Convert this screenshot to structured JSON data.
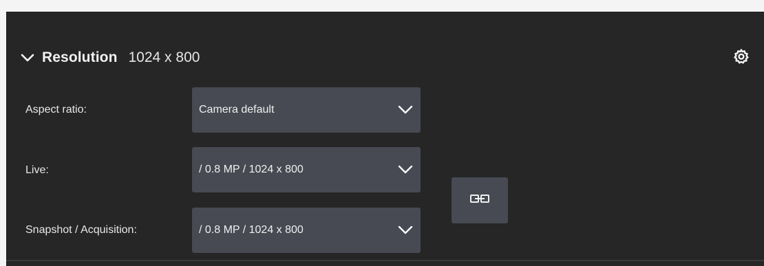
{
  "header": {
    "title": "Resolution",
    "value": "1024 x 800"
  },
  "rows": [
    {
      "label": "Aspect ratio:",
      "selected": "Camera default"
    },
    {
      "label": "Live:",
      "selected": "/ 0.8 MP / 1024 x 800"
    },
    {
      "label": "Snapshot / Acquisition:",
      "selected": "/ 0.8 MP / 1024 x 800"
    }
  ],
  "icons": {
    "collapse": "chevron-down-icon",
    "settings": "gear-icon",
    "dropdown": "chevron-down-icon",
    "link": "link-icon"
  },
  "colors": {
    "panel_bg": "#262626",
    "control_bg": "#474a52",
    "text": "#e8e8e8"
  }
}
